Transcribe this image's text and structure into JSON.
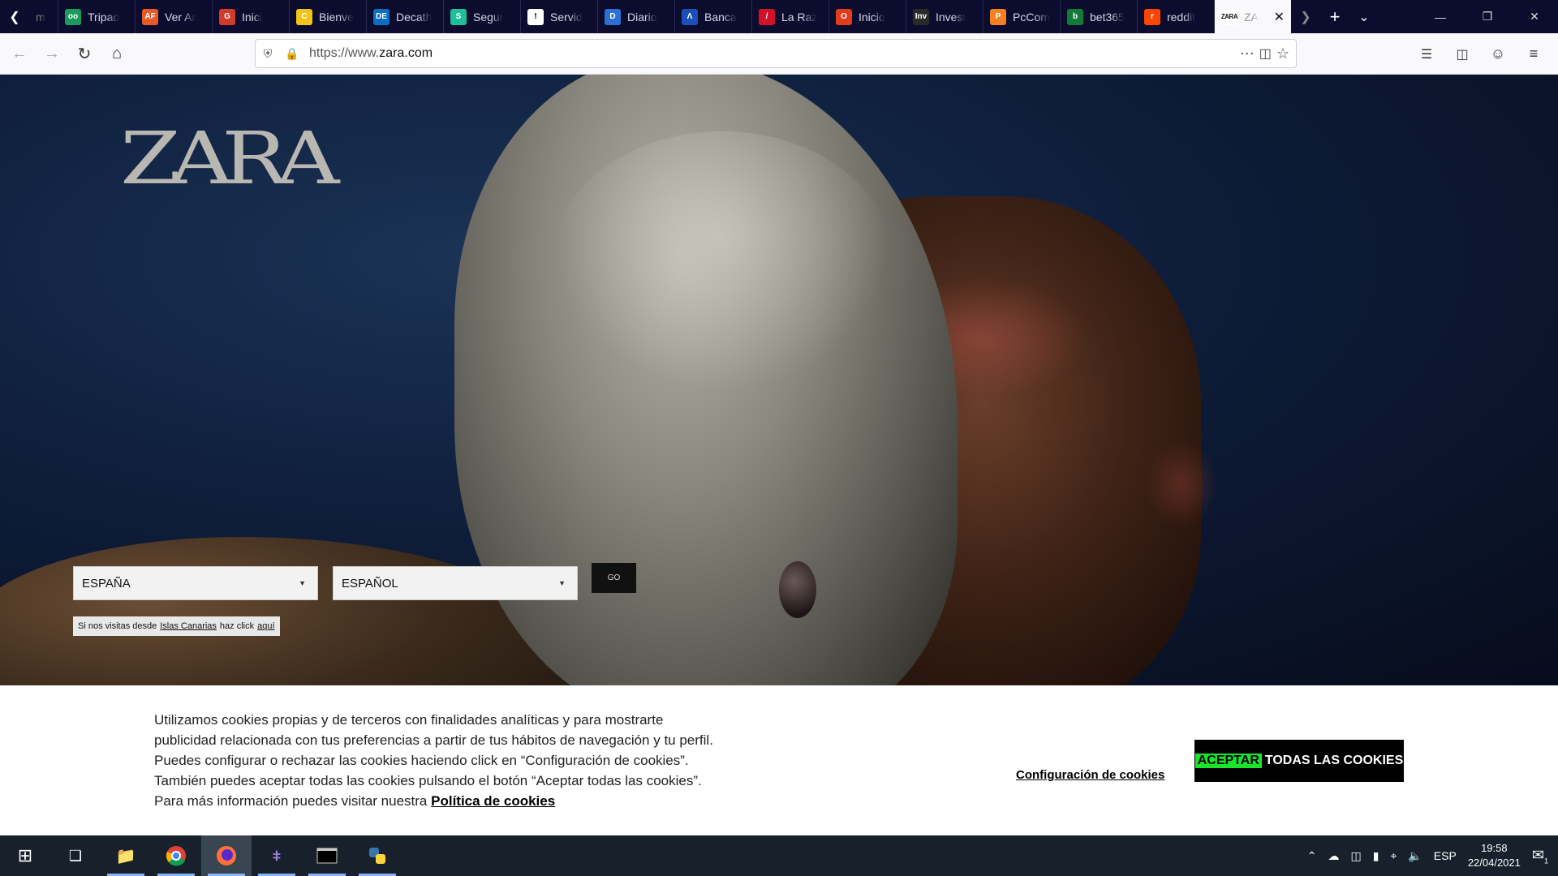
{
  "browser": {
    "tabs": [
      {
        "label": "Tripad",
        "color": "#1a9a5b",
        "glyph": "oo"
      },
      {
        "label": "Ver Ar",
        "color": "#e85a2a",
        "glyph": "AF"
      },
      {
        "label": "Inici",
        "color": "#d23a2a",
        "glyph": "G"
      },
      {
        "label": "Bienve",
        "color": "#f0c419",
        "glyph": "C"
      },
      {
        "label": "Decath",
        "color": "#0a6fc2",
        "glyph": "DE"
      },
      {
        "label": "Segur",
        "color": "#1fbf9a",
        "glyph": "S"
      },
      {
        "label": "Servid",
        "color": "#ffffff",
        "glyph": "!"
      },
      {
        "label": "Diario",
        "color": "#2e6fd6",
        "glyph": "D"
      },
      {
        "label": "Banca",
        "color": "#1d4fb8",
        "glyph": "Λ"
      },
      {
        "label": "La Raz",
        "color": "#d3122a",
        "glyph": "/"
      },
      {
        "label": "Inicio",
        "color": "#e23b1d",
        "glyph": "O"
      },
      {
        "label": "Invest",
        "color": "#2a2a2a",
        "glyph": "Inv"
      },
      {
        "label": "PcCom",
        "color": "#f58220",
        "glyph": "P"
      },
      {
        "label": "bet365",
        "color": "#127b3a",
        "glyph": "b"
      },
      {
        "label": "reddit",
        "color": "#ff4500",
        "glyph": "r"
      }
    ],
    "active_tab": {
      "label": "ZA",
      "favicon_text": "ZARA"
    },
    "url": {
      "prefix": "https://www.",
      "domain": "zara.com"
    }
  },
  "page": {
    "logo": "ZARA",
    "country_select": "ESPAÑA",
    "language_select": "ESPAÑOL",
    "go_label": "GO",
    "canarias": {
      "before": "Si nos visitas desde",
      "link1": "Islas Canarias",
      "middle": "haz click",
      "link2": "aquí"
    }
  },
  "cookie_banner": {
    "lines": [
      "Utilizamos cookies propias y de terceros con finalidades analíticas y para mostrarte",
      "publicidad relacionada con tus preferencias a partir de tus hábitos de navegación y tu perfil.",
      "Puedes configurar o rechazar las cookies haciendo click en “Configuración de cookies”.",
      "También puedes aceptar todas las cookies pulsando el botón “Aceptar todas las cookies”."
    ],
    "last_line_prefix": "Para más información puedes visitar nuestra",
    "policy_link": "Política de cookies",
    "config_link": "Configuración de cookies",
    "accept_highlight": "ACEPTAR",
    "accept_rest": "TODAS LAS COOKIES"
  },
  "taskbar": {
    "language": "ESP",
    "time": "19:58",
    "date": "22/04/2021",
    "notification_count": "1"
  }
}
